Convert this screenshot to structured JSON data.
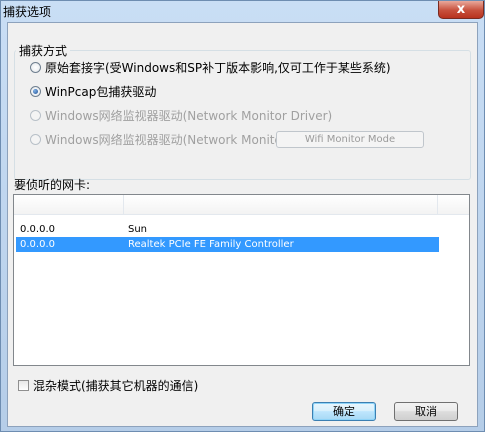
{
  "window": {
    "title": "捕获选项",
    "close_glyph": "x"
  },
  "capture_mode": {
    "group_title": "捕获方式",
    "options": [
      {
        "label": "原始套接字(受Windows和SP补丁版本影响,仅可工作于某些系统)",
        "checked": false,
        "enabled": true
      },
      {
        "label": "WinPcap包捕获驱动",
        "checked": true,
        "enabled": true
      },
      {
        "label": "Windows网络监视器驱动(Network Monitor Driver)",
        "checked": false,
        "enabled": false
      },
      {
        "label": "Windows网络监视器驱动(Network Monitor Driver) 3",
        "checked": false,
        "enabled": false
      }
    ],
    "wifi_button_label": "Wifi Monitor Mode"
  },
  "nic": {
    "label": "要侦听的网卡:",
    "rows": [
      {
        "ip": "0.0.0.0",
        "name": "Sun",
        "selected": false
      },
      {
        "ip": "0.0.0.0",
        "name": "Realtek PCIe FE Family Controller",
        "selected": true
      }
    ]
  },
  "promiscuous": {
    "label": "混杂模式(捕获其它机器的通信)",
    "checked": false
  },
  "buttons": {
    "ok": "确定",
    "cancel": "取消"
  }
}
